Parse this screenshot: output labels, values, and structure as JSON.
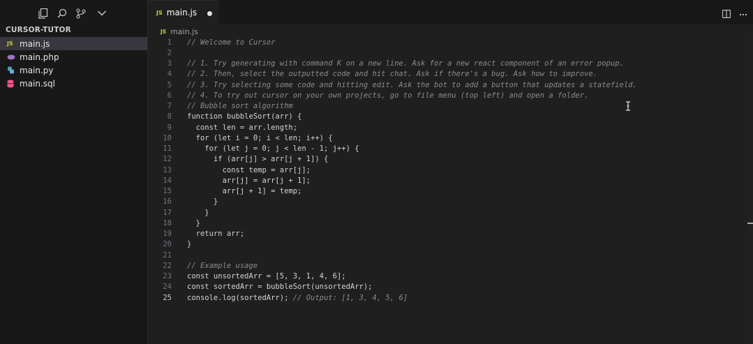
{
  "sidebar": {
    "title": "CURSOR-TUTOR",
    "toolbar_icons": [
      "files-icon",
      "search-icon",
      "source-control-icon",
      "chevron-down-icon"
    ],
    "files": [
      {
        "name": "main.js",
        "badge": "JS",
        "badge_color": "#cbcb41",
        "active": true
      },
      {
        "name": "main.php",
        "badge": "php",
        "badge_color": "#a074c4",
        "active": false
      },
      {
        "name": "main.py",
        "badge": "py",
        "badge_color": "#519aba",
        "active": false
      },
      {
        "name": "main.sql",
        "badge": "db",
        "badge_color": "#f55385",
        "active": false
      }
    ]
  },
  "editor": {
    "tab": {
      "badge": "JS",
      "label": "main.js",
      "modified": true
    },
    "breadcrumb": {
      "badge": "JS",
      "label": "main.js"
    },
    "current_line": 25,
    "lines": [
      {
        "n": "1",
        "text": "// Welcome to Cursor"
      },
      {
        "n": "2",
        "text": ""
      },
      {
        "n": "3",
        "text": "// 1. Try generating with command K on a new line. Ask for a new react component of an error popup."
      },
      {
        "n": "4",
        "text": "// 2. Then, select the outputted code and hit chat. Ask if there's a bug. Ask how to improve."
      },
      {
        "n": "5",
        "text": "// 3. Try selecting some code and hitting edit. Ask the bot to add a button that updates a statefield."
      },
      {
        "n": "6",
        "text": "// 4. To try out cursor on your own projects, go to file menu (top left) and open a folder."
      },
      {
        "n": "7",
        "text": "// Bubble sort algorithm"
      },
      {
        "n": "8",
        "text": "function bubbleSort(arr) {"
      },
      {
        "n": "9",
        "text": "  const len = arr.length;"
      },
      {
        "n": "10",
        "text": "  for (let i = 0; i < len; i++) {"
      },
      {
        "n": "11",
        "text": "    for (let j = 0; j < len - 1; j++) {"
      },
      {
        "n": "12",
        "text": "      if (arr[j] > arr[j + 1]) {"
      },
      {
        "n": "13",
        "text": "        const temp = arr[j];"
      },
      {
        "n": "14",
        "text": "        arr[j] = arr[j + 1];"
      },
      {
        "n": "15",
        "text": "        arr[j + 1] = temp;"
      },
      {
        "n": "16",
        "text": "      }"
      },
      {
        "n": "17",
        "text": "    }"
      },
      {
        "n": "18",
        "text": "  }"
      },
      {
        "n": "19",
        "text": "  return arr;"
      },
      {
        "n": "20",
        "text": "}"
      },
      {
        "n": "21",
        "text": ""
      },
      {
        "n": "22",
        "text": "// Example usage"
      },
      {
        "n": "23",
        "text": "const unsortedArr = [5, 3, 1, 4, 6];"
      },
      {
        "n": "24",
        "text": "const sortedArr = bubbleSort(unsortedArr);"
      },
      {
        "n": "25",
        "text": "console.log(sortedArr);",
        "comment": " // Output: [1, 3, 4, 5, 6]"
      }
    ]
  }
}
